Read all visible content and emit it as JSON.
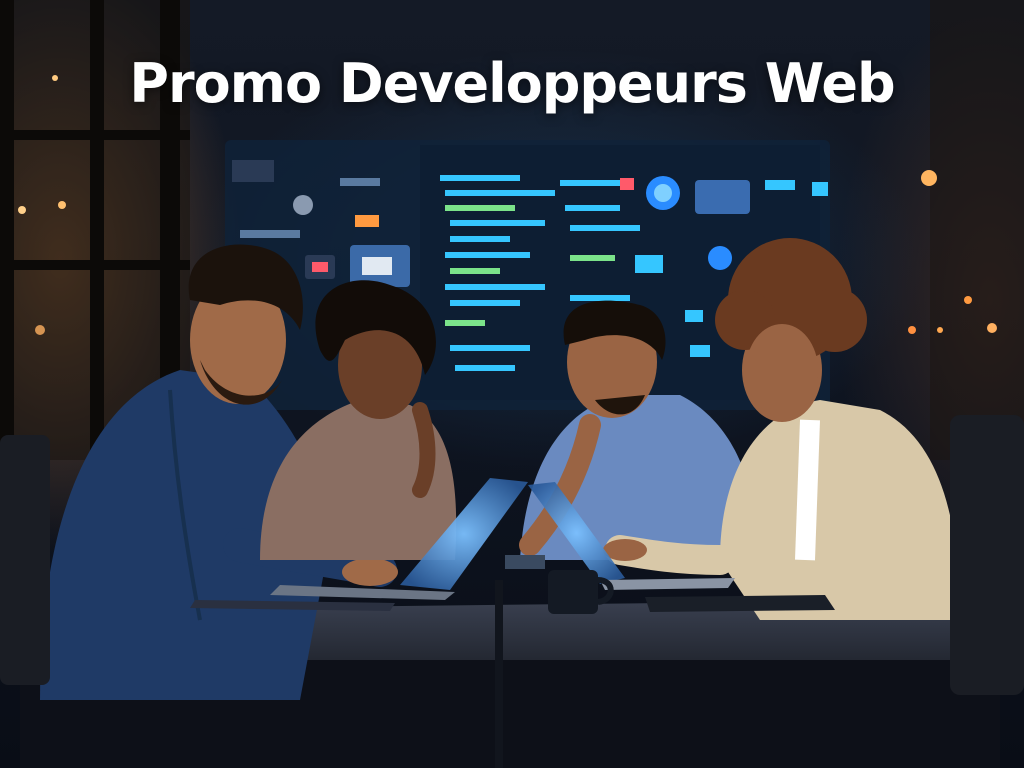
{
  "headline": {
    "text": "Promo Developpeurs Web",
    "color": "#ffffff"
  },
  "palette": {
    "background": "#0b1220",
    "screen_glow": "#1e4a7a",
    "code_cyan": "#35c6ff",
    "code_green": "#7be38a",
    "window_warm": "#c98a4a",
    "table": "#2a2f38",
    "laptop_glow": "#5fa8ff"
  },
  "scene": {
    "description_icon": "people-at-laptops-illustration",
    "people_count": 4,
    "laptop_count": 3
  }
}
